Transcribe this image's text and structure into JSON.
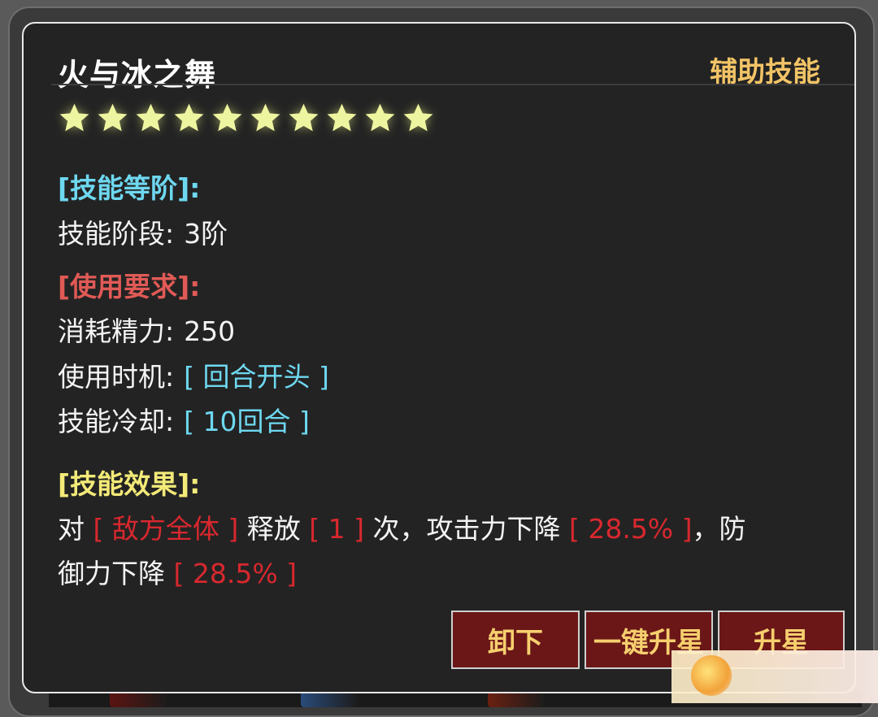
{
  "skill": {
    "name": "火与冰之舞",
    "category": "辅助技能",
    "star_count": 10,
    "star_max": 10
  },
  "tier_section": {
    "header": "[技能等阶]:",
    "label": "技能阶段:",
    "value": "3阶"
  },
  "requirement_section": {
    "header": "[使用要求]:",
    "energy_label": "消耗精力:",
    "energy_value": "250",
    "timing_label": "使用时机:",
    "timing_value": "[ 回合开头 ]",
    "cooldown_label": "技能冷却:",
    "cooldown_value": "[ 10回合 ]"
  },
  "effect_section": {
    "header": "[技能效果]:",
    "l1_a": "对",
    "l1_target": "[ 敌方全体 ]",
    "l1_b": "释放",
    "l1_times": "[ 1 ]",
    "l1_c": "次，攻击力下降",
    "l1_atk": "[ 28.5% ]",
    "l1_d": "，防",
    "l2_a": "御力下降",
    "l2_def": "[ 28.5% ]"
  },
  "buttons": {
    "unequip": "卸下",
    "one_click_star": "一键升星",
    "upgrade_star": "升星"
  },
  "colors": {
    "header_cyan": "#6ed8f0",
    "header_red": "#e05a56",
    "header_yellow": "#f3ea78",
    "category_gold": "#f2c466",
    "highlight_red": "#d8282e",
    "button_bg": "#6b1717"
  }
}
